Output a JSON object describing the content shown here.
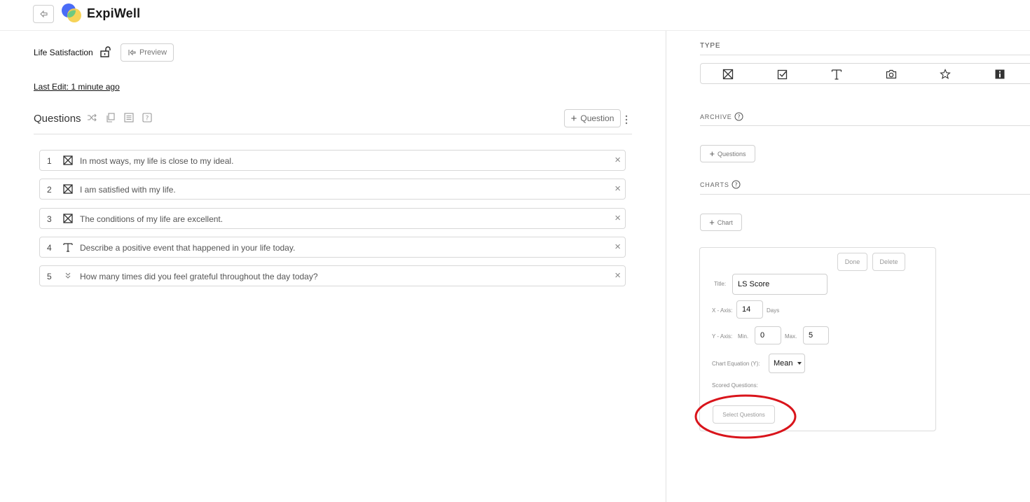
{
  "app": {
    "name": "ExpiWell"
  },
  "survey": {
    "title": "Life Satisfaction",
    "preview_label": "Preview",
    "last_edit": "Last Edit: 1 minute ago"
  },
  "questions_panel": {
    "heading": "Questions",
    "add_label": "Question",
    "items": [
      {
        "number": "1",
        "type_icon": "multiple-choice-icon",
        "text": "In most ways, my life is close to my ideal."
      },
      {
        "number": "2",
        "type_icon": "multiple-choice-icon",
        "text": "I am satisfied with my life."
      },
      {
        "number": "3",
        "type_icon": "multiple-choice-icon",
        "text": "The conditions of my life are excellent."
      },
      {
        "number": "4",
        "type_icon": "text-icon",
        "text": "Describe a positive event that happened in your life today."
      },
      {
        "number": "5",
        "type_icon": "numeric-icon",
        "text": "How many times did you feel grateful throughout the day today?"
      }
    ]
  },
  "right_panel": {
    "type_label": "TYPE",
    "type_icons": [
      "multiple-choice-icon",
      "checkbox-icon",
      "text-icon",
      "camera-icon",
      "star-icon",
      "info-icon"
    ],
    "archive_label": "ARCHIVE",
    "archive_button": "Questions",
    "charts_label": "CHARTS",
    "chart_button": "Chart",
    "chart_card": {
      "done_label": "Done",
      "delete_label": "Delete",
      "title_label": "Title:",
      "title_value": "LS Score",
      "x_axis_label": "X - Axis:",
      "x_axis_value": "14",
      "x_axis_unit": "Days",
      "y_axis_label": "Y - Axis:",
      "y_min_label": "Min.",
      "y_min_value": "0",
      "y_max_label": "Max.",
      "y_max_value": "5",
      "equation_label": "Chart Equation (Y):",
      "equation_value": "Mean",
      "scored_label": "Scored Questions:",
      "select_button": "Select Questions"
    }
  },
  "colors": {
    "highlight_ellipse": "#d9141b",
    "logo_blue": "#4a6cf7",
    "logo_green": "#57c98a",
    "logo_yellow": "#f5cf4a"
  }
}
